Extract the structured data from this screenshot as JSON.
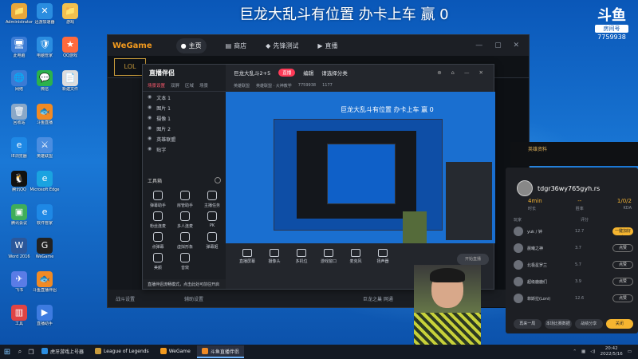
{
  "stream_title": "巨龙大乱斗有位置  办卡上车  赢  0",
  "douyu": {
    "logo": "斗鱼",
    "tag": "房间号",
    "room": "7759938"
  },
  "desktop_icons": [
    {
      "label": "Administrator",
      "color": "#e8a73a",
      "glyph": "📁"
    },
    {
      "label": "迅游加速器",
      "color": "#2a8de0",
      "glyph": "✕"
    },
    {
      "label": "游戏",
      "color": "#f2c14e",
      "glyph": "📁"
    },
    {
      "label": "此电脑",
      "color": "#3a7bd5",
      "glyph": "🖥"
    },
    {
      "label": "电脑管家",
      "color": "#2a8de0",
      "glyph": "🛡"
    },
    {
      "label": "QQ游戏",
      "color": "#ff6a3d",
      "glyph": "★"
    },
    {
      "label": "网络",
      "color": "#3a7bd5",
      "glyph": "🌐"
    },
    {
      "label": "微信",
      "color": "#2bb24c",
      "glyph": "💬"
    },
    {
      "label": "新建文件",
      "color": "#dddddd",
      "glyph": "📄"
    },
    {
      "label": "回收站",
      "color": "#8aa8c8",
      "glyph": "🗑"
    },
    {
      "label": "斗鱼直播",
      "color": "#f08a24",
      "glyph": "🐟"
    },
    {
      "label": "IE浏览器",
      "color": "#1e88e5",
      "glyph": "e"
    },
    {
      "label": "英雄联盟",
      "color": "#4a8de0",
      "glyph": "⚔"
    },
    {
      "label": "腾讯QQ",
      "color": "#111111",
      "glyph": "🐧"
    },
    {
      "label": "Microsoft Edge",
      "color": "#1aa3e0",
      "glyph": "e"
    },
    {
      "label": "腾讯会议",
      "color": "#3fae5a",
      "glyph": "▣"
    },
    {
      "label": "软件管家",
      "color": "#1e88e5",
      "glyph": "e"
    },
    {
      "label": "Word 2016",
      "color": "#2b579a",
      "glyph": "W"
    },
    {
      "label": "WeGame",
      "color": "#222222",
      "glyph": "G"
    },
    {
      "label": "飞书",
      "color": "#5a7ce6",
      "glyph": "✈"
    },
    {
      "label": "斗鱼直播伴侣",
      "color": "#f08a24",
      "glyph": "🐟"
    },
    {
      "label": "工具",
      "color": "#e04444",
      "glyph": "▥"
    },
    {
      "label": "直播助手",
      "color": "#3d7be0",
      "glyph": "▶"
    }
  ],
  "wegame": {
    "logo": "WeGame",
    "tabs": [
      "主页",
      "商店",
      "先锋测试",
      "直播"
    ],
    "lol_logo": "LOL",
    "bottom_left": "战斗设置",
    "bottom_mid": "辅助设置",
    "bottom_right": "巨龙之巢 网通"
  },
  "helper": {
    "logo": "直播伴侣",
    "tabs": [
      "场景设置",
      "双屏",
      "区域",
      "场景"
    ],
    "scenes": [
      "文本 1",
      "图片 1",
      "摄像 1",
      "图片 2",
      "英雄联盟",
      "贴字"
    ],
    "tools_title": "工具箱",
    "tools": [
      "弹幕助手",
      "房管助手",
      "主播任务",
      "粉丝连麦",
      "多人连麦",
      "PK",
      "点弹幕",
      "虚拟形象",
      "弹幕姬",
      "美颜",
      "音效"
    ],
    "notice": "直播伴侣流畅模式，点击此处可前往开启",
    "room_title": "巨龙大乱斗2+5",
    "live_badge": "直播",
    "edit": "编辑",
    "select_category": "请选择分类",
    "category": "英雄联盟",
    "area": "英雄联盟 · 大神教学",
    "room_code": "7759938",
    "viewers": "1177",
    "mini_title": "巨龙大乱斗有位置  办卡上车  赢  0",
    "bottom_tools": [
      "直播屏幕",
      "摄像头",
      "多机位",
      "游戏窗口",
      "麦克风",
      "扬声器"
    ],
    "start_live": "开始直播"
  },
  "match_panel": {
    "header": "英雄资料",
    "player": "tdgr36wy765gyh.rs",
    "stats": [
      "4min",
      "--",
      "1/0/2"
    ],
    "stat_caps": [
      "时长",
      "胜率",
      "KDA"
    ],
    "col_heads": [
      "玩家",
      "评分"
    ],
    "rows": [
      {
        "name": "yuk / 钟",
        "score": "12.7",
        "btn": "一键加好友",
        "primary": true
      },
      {
        "name": "晨曦之神",
        "score": "3.7",
        "btn": "点赞",
        "primary": false
      },
      {
        "name": "北极星罗兰",
        "score": "5.7",
        "btn": "点赞",
        "primary": false
      },
      {
        "name": "超级鹿鹿们",
        "score": "3.9",
        "btn": "点赞",
        "primary": false
      },
      {
        "name": "菲斯拉(Loni)",
        "score": "12.6",
        "btn": "点赞",
        "primary": false
      }
    ],
    "footer": [
      "再来一局",
      "本场比赛数据",
      "战绩分享",
      "关闭"
    ]
  },
  "taskbar": {
    "apps": [
      {
        "label": "虎牙游戏上号器",
        "color": "#2a8de0",
        "active": false
      },
      {
        "label": "League of Legends",
        "color": "#c89b3c",
        "active": false
      },
      {
        "label": "WeGame",
        "color": "#f39a1e",
        "active": false
      },
      {
        "label": "斗鱼直播伴侣",
        "color": "#f08a24",
        "active": true
      }
    ],
    "time": "20:42",
    "date": "2022/5/16"
  }
}
